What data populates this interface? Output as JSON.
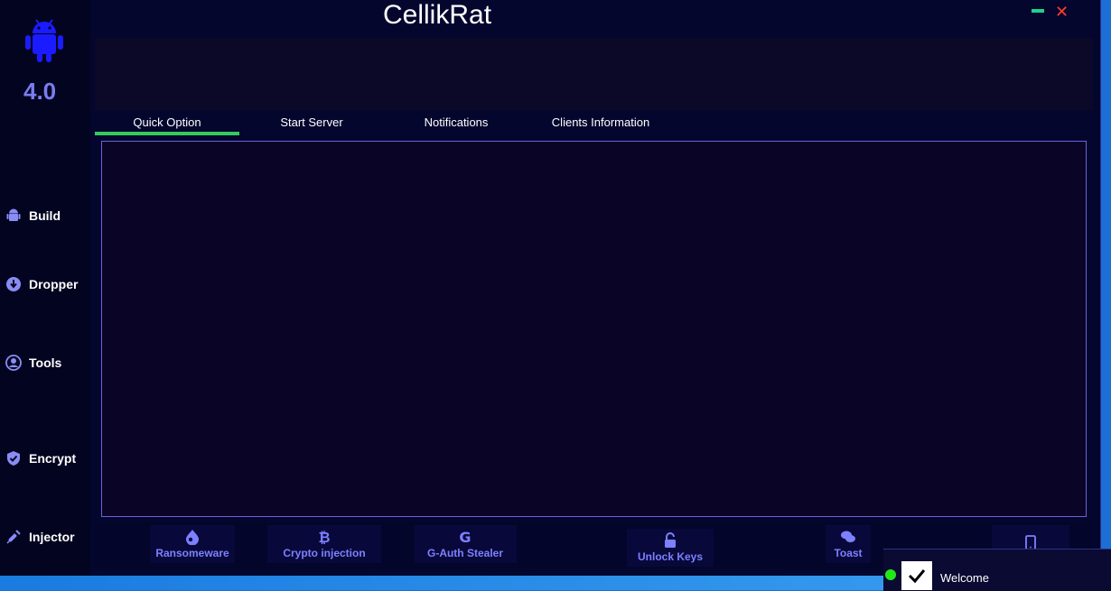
{
  "app": {
    "title": "CellikRat",
    "version": "4.0"
  },
  "sidebar": {
    "items": [
      {
        "label": "Build",
        "icon": "android-icon"
      },
      {
        "label": "Dropper",
        "icon": "download-circle-icon"
      },
      {
        "label": "Tools",
        "icon": "user-tools-icon"
      },
      {
        "label": "Encrypt",
        "icon": "shield-check-icon"
      },
      {
        "label": "Injector",
        "icon": "syringe-icon"
      }
    ]
  },
  "tabs": [
    {
      "label": "Quick Option",
      "active": true
    },
    {
      "label": "Start Server"
    },
    {
      "label": "Notifications"
    },
    {
      "label": "Clients Information"
    }
  ],
  "quick_actions": [
    {
      "label": "Ransomeware",
      "icon": "drupal-drop-icon"
    },
    {
      "label": "Crypto injection",
      "icon": "bitcoin-icon"
    },
    {
      "label": "G-Auth Stealer",
      "icon": "google-g-icon"
    },
    {
      "label": "Unlock Keys",
      "icon": "unlock-icon"
    },
    {
      "label": "Toast",
      "icon": "chat-bubbles-icon"
    },
    {
      "label": "",
      "icon": "tablet-icon"
    }
  ],
  "notification": {
    "text": "Welcome"
  },
  "colors": {
    "accent": "#7a7cf0",
    "active_tab": "#37c95a",
    "minimize": "#1fd18b",
    "close": "#ff3b2b",
    "status_online": "#22e81a"
  }
}
